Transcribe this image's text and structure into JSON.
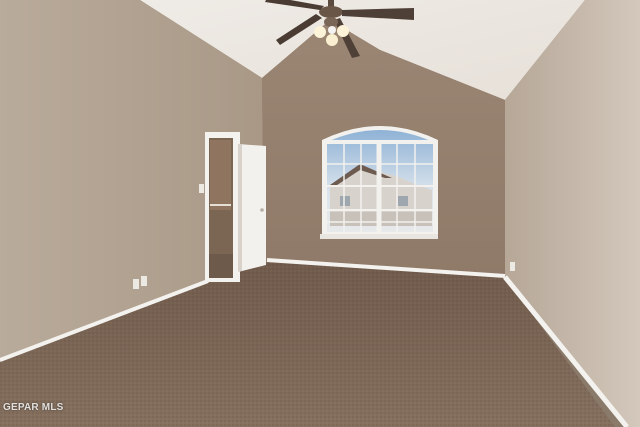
{
  "watermark": {
    "text": "GEPAR MLS"
  },
  "colors": {
    "ceiling": "#f1ede7",
    "left_wall": "#b5a797",
    "back_wall": "#9d8876",
    "right_wall": "#c9bdb0",
    "baseboard": "#f4f2ee",
    "carpet": "#7c6656",
    "window_frame": "#f2f1ee",
    "door": "#f3f1ee"
  },
  "icons": [
    "ceiling-fan-icon"
  ]
}
